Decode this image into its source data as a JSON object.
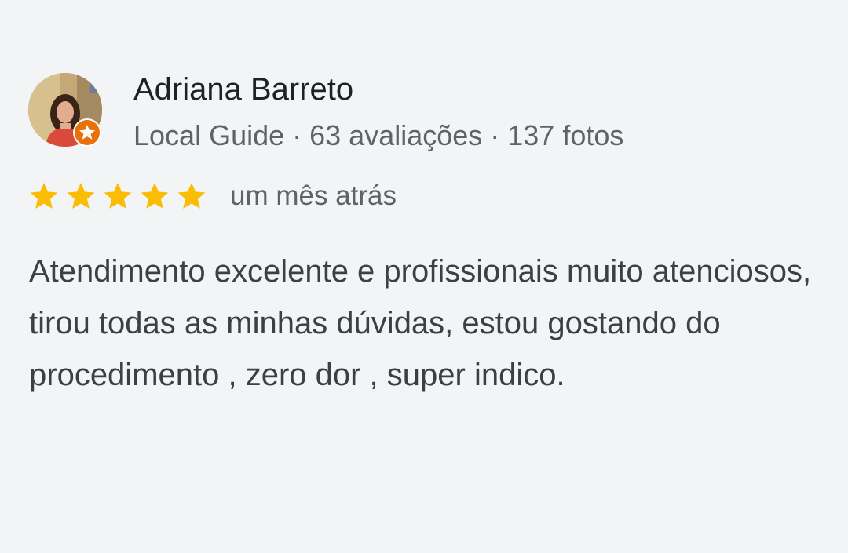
{
  "reviewer": {
    "name": "Adriana Barreto",
    "meta": "Local Guide · 63 avaliações · 137 fotos"
  },
  "rating": {
    "stars": 5,
    "max": 5,
    "time": "um mês atrás"
  },
  "review": {
    "text": "Atendimento excelente e profissionais muito atenciosos, tirou todas as minhas dúvidas, estou gostando do procedimento , zero dor , super indico."
  },
  "colors": {
    "star": "#fbbc04",
    "badge": "#e8710a",
    "background": "#f3f4f6"
  },
  "icons": {
    "avatar": "profile-photo",
    "badge": "local-guide-badge-icon",
    "star": "star-icon"
  }
}
